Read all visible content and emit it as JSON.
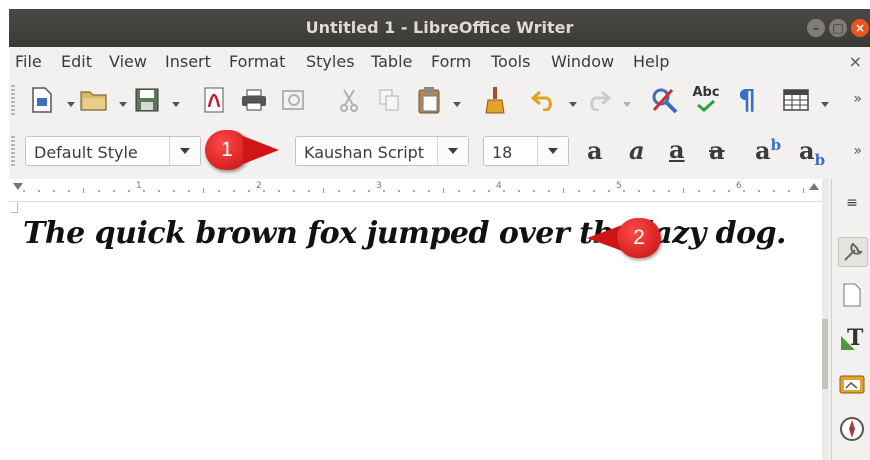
{
  "window": {
    "title": "Untitled 1 - LibreOffice Writer",
    "minimize_icon": "minimize-icon",
    "maximize_icon": "maximize-icon",
    "close_icon": "close-icon"
  },
  "menubar": {
    "items": [
      "File",
      "Edit",
      "View",
      "Insert",
      "Format",
      "Styles",
      "Table",
      "Form",
      "Tools",
      "Window",
      "Help"
    ],
    "close_doc": "×"
  },
  "toolbar_standard": {
    "icons": [
      "new-document-icon",
      "open-icon",
      "save-icon",
      "export-pdf-icon",
      "print-icon",
      "print-preview-icon",
      "cut-icon",
      "copy-icon",
      "paste-icon",
      "clone-formatting-icon",
      "undo-icon",
      "redo-icon",
      "find-replace-icon",
      "spellcheck-icon",
      "formatting-marks-icon",
      "insert-table-icon"
    ],
    "spellcheck_label": "Abc",
    "formatting_marks_glyph": "¶",
    "overflow": "»"
  },
  "toolbar_formatting": {
    "paragraph_style": "Default Style",
    "font_name": "Kaushan Script",
    "font_size": "18",
    "buttons": {
      "bold": "a",
      "italic": "a",
      "underline": "a",
      "strikethrough": "a",
      "superscript_base": "a",
      "superscript_sup": "b",
      "subscript_base": "a",
      "subscript_sub": "b"
    },
    "overflow": "»"
  },
  "callouts": [
    "1",
    "2"
  ],
  "ruler": {
    "labels": [
      "1",
      "2",
      "3",
      "4",
      "5",
      "6"
    ]
  },
  "document": {
    "text": "The quick brown fox jumped over the lazy dog."
  },
  "sidebar": {
    "menu_glyph": "≡",
    "icons": [
      "sidebar-menu-icon",
      "properties-icon",
      "page-icon",
      "styles-icon",
      "gallery-icon",
      "navigator-icon"
    ],
    "styles_glyph": "T"
  },
  "colors": {
    "titlebar": "#3b3a37",
    "close_button": "#e95420",
    "callout_red": "#d51818"
  }
}
